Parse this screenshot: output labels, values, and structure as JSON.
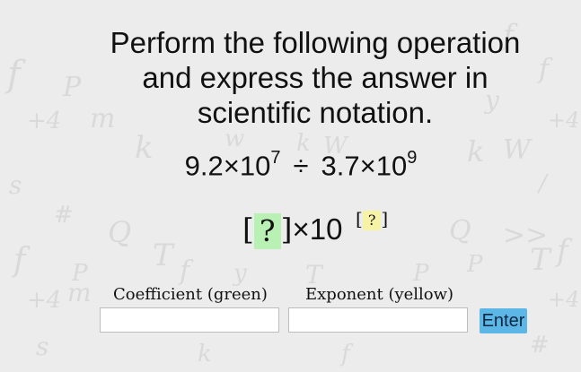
{
  "question": {
    "line1": "Perform the following operation",
    "line2": "and express the answer in",
    "line3": "scientific notation."
  },
  "expression": {
    "a_coefficient": "9.2",
    "a_base": "×10",
    "a_exponent": "7",
    "operator": "÷",
    "b_coefficient": "3.7",
    "b_base": "×10",
    "b_exponent": "9"
  },
  "answer": {
    "bracket_open": "[",
    "coefficient_placeholder": "?",
    "bracket_close": "]",
    "base": "×10",
    "exponent_bracket_open": "[",
    "exponent_placeholder": "?",
    "exponent_bracket_close": "]"
  },
  "form": {
    "coefficient_label": "Coefficient (green)",
    "coefficient_value": "",
    "exponent_label": "Exponent (yellow)",
    "exponent_value": "",
    "enter_label": "Enter"
  },
  "colors": {
    "background": "#ececec",
    "coefficient_highlight": "#b9f0b4",
    "exponent_highlight": "#f7f3a6",
    "enter_button": "#5cb6e6"
  }
}
